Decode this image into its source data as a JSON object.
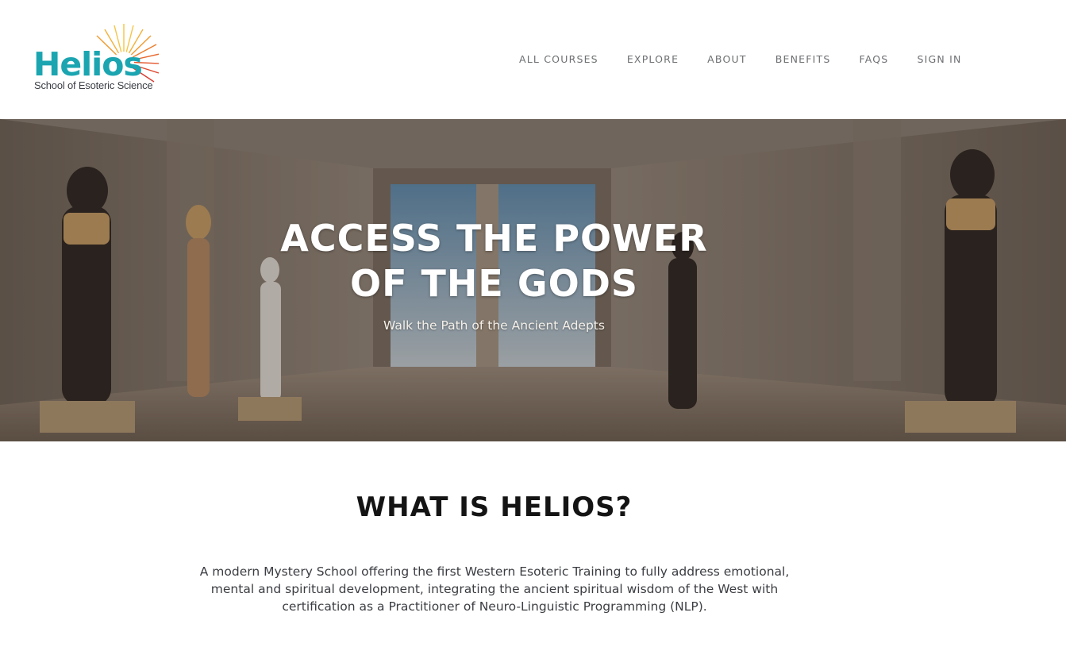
{
  "brand": {
    "name": "Helios",
    "tagline": "School of Esoteric Science",
    "colors": {
      "teal": "#1ba5b1",
      "sun_orange": "#f29a2e",
      "sun_yellow": "#f6c443",
      "sun_red": "#e4572e"
    },
    "icon": "sunburst-icon"
  },
  "nav": {
    "items": [
      {
        "label": "ALL COURSES"
      },
      {
        "label": "EXPLORE"
      },
      {
        "label": "ABOUT"
      },
      {
        "label": "BENEFITS"
      },
      {
        "label": "FAQS"
      },
      {
        "label": "SIGN IN"
      }
    ]
  },
  "hero": {
    "title_line1": "ACCESS THE POWER",
    "title_line2": "OF THE GODS",
    "subtitle": "Walk the Path of the Ancient Adepts"
  },
  "intro": {
    "heading": "WHAT IS HELIOS?",
    "body": "A modern Mystery School offering the first Western Esoteric Training to fully address emotional, mental and spiritual development, integrating the ancient spiritual wisdom of the West with certification as a Practitioner of Neuro-Linguistic Programming (NLP)."
  }
}
